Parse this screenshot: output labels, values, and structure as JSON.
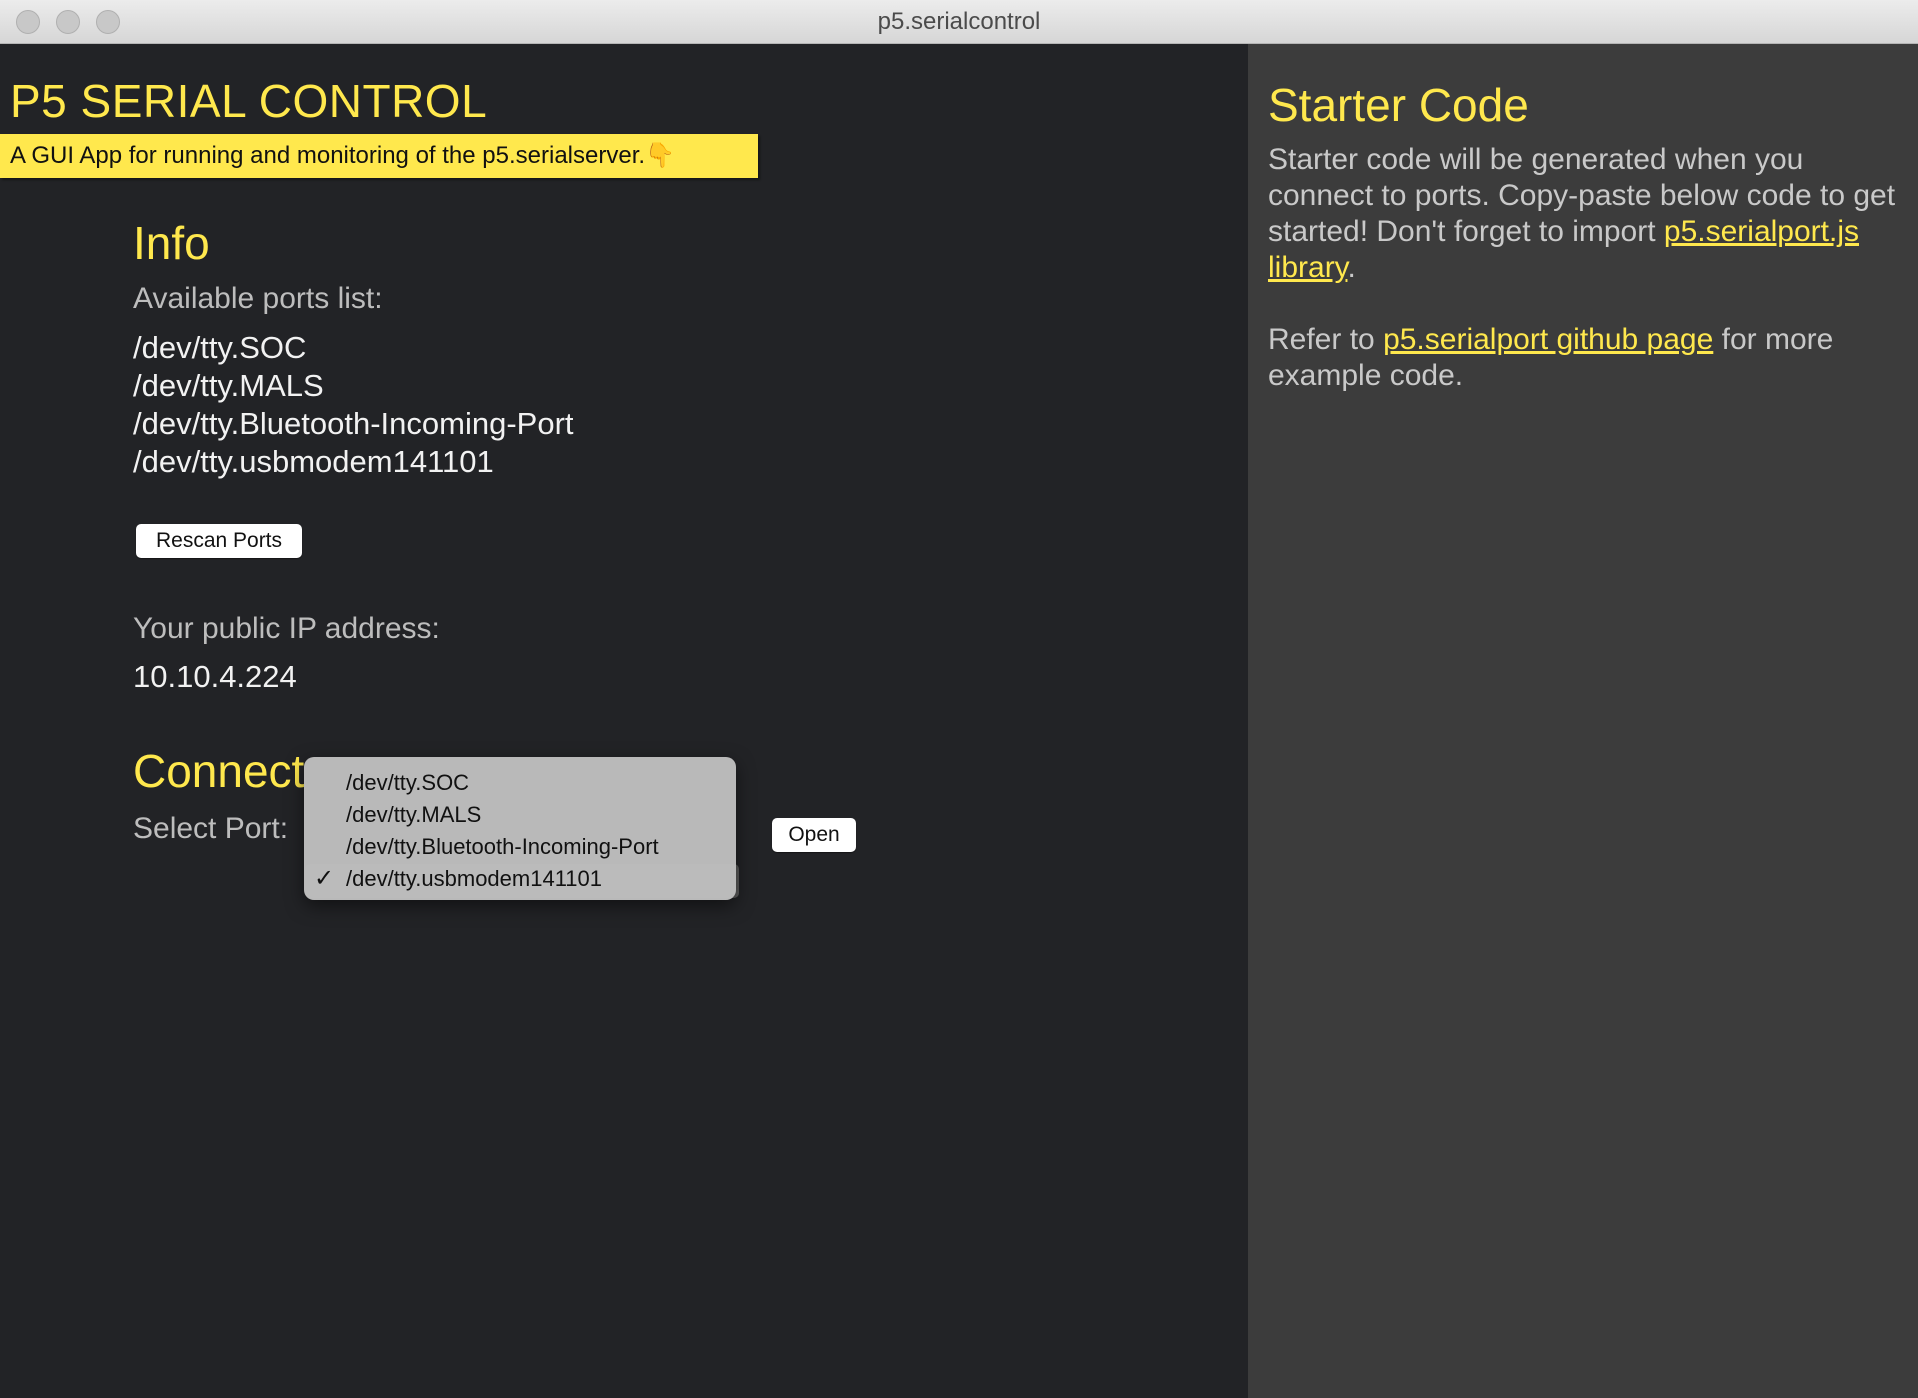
{
  "window": {
    "title": "p5.serialcontrol"
  },
  "header": {
    "app_title": "P5 SERIAL CONTROL",
    "tagline": "A GUI App for running and monitoring of the p5.serialserver.👇"
  },
  "info": {
    "heading": "Info",
    "ports_label": "Available ports list:",
    "ports": [
      "/dev/tty.SOC",
      "/dev/tty.MALS",
      "/dev/tty.Bluetooth-Incoming-Port",
      "/dev/tty.usbmodem141101"
    ],
    "rescan_label": "Rescan Ports",
    "ip_label": "Your public IP address:",
    "ip_value": "10.10.4.224"
  },
  "connect": {
    "heading": "Connect",
    "select_label": "Select Port:",
    "options": [
      "/dev/tty.SOC",
      "/dev/tty.MALS",
      "/dev/tty.Bluetooth-Incoming-Port",
      "/dev/tty.usbmodem141101"
    ],
    "selected": "/dev/tty.usbmodem141101",
    "open_label": "Open"
  },
  "starter": {
    "heading": "Starter Code",
    "para1_before": "Starter code will be generated when you connect to ports. Copy-paste below code to get started! Don't forget to import ",
    "para1_link": "p5.serialport.js library",
    "para1_after": ".",
    "para2_before": "Refer to ",
    "para2_link": "p5.serialport github page",
    "para2_after": " for more example code."
  },
  "colors": {
    "accent": "#ffe84d",
    "left_bg": "#222326",
    "right_bg": "#3c3c3c"
  }
}
